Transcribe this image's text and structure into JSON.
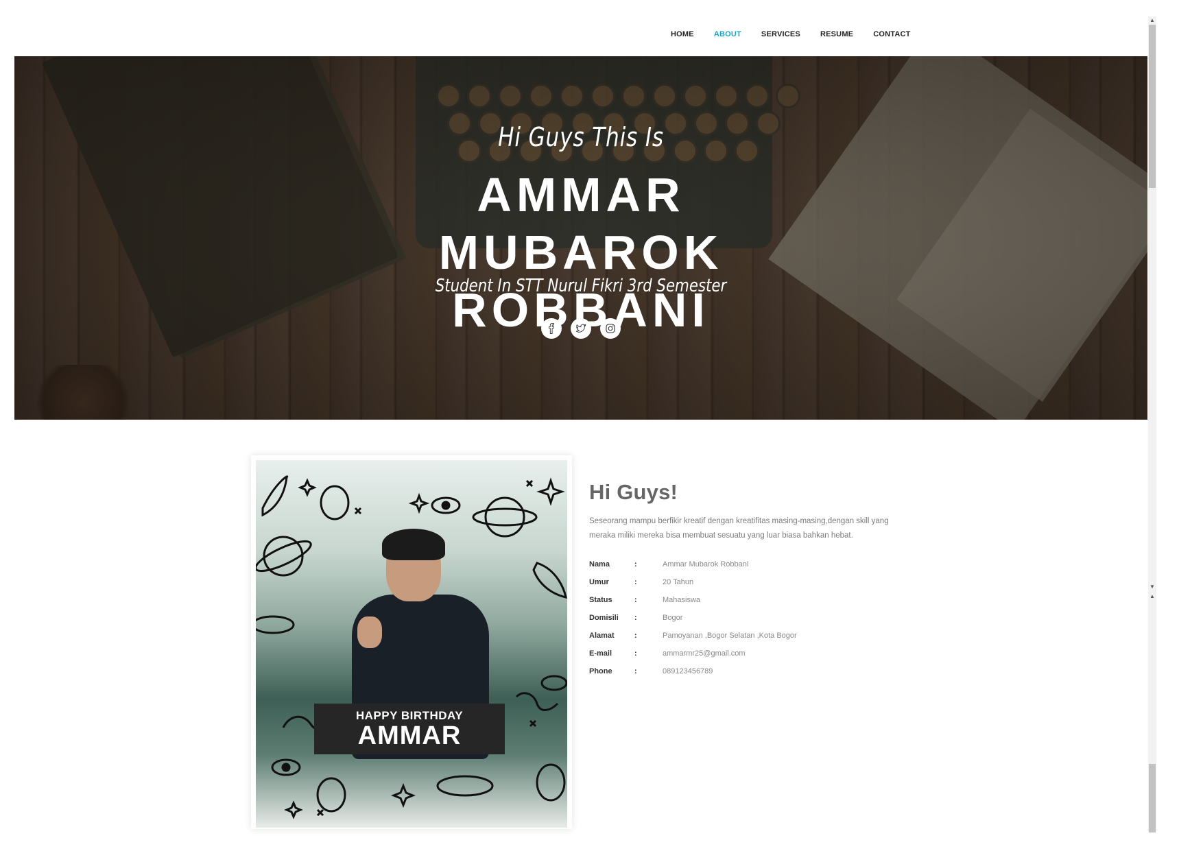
{
  "nav": {
    "items": [
      {
        "label": "HOME",
        "active": false
      },
      {
        "label": "ABOUT",
        "active": true
      },
      {
        "label": "SERVICES",
        "active": false
      },
      {
        "label": "RESUME",
        "active": false
      },
      {
        "label": "CONTACT",
        "active": false
      }
    ],
    "active_color": "#1aa3c8"
  },
  "hero": {
    "greeting": "Hi Guys This Is",
    "name_line1": "AMMAR MUBAROK",
    "name_line2": "ROBBANI",
    "subtitle": "Student In STT Nurul Fikri 3rd Semester",
    "socials": [
      "facebook-icon",
      "twitter-icon",
      "instagram-icon"
    ]
  },
  "photo": {
    "banner_top": "HAPPY BIRTHDAY",
    "banner_main": "AMMAR"
  },
  "about": {
    "title": "Hi Guys!",
    "description": "Seseorang mampu berfikir kreatif dengan kreatifitas masing-masing,dengan skill yang meraka miliki mereka bisa membuat sesuatu yang luar biasa bahkan hebat.",
    "colon": ":",
    "details": [
      {
        "label": "Nama",
        "value": "Ammar Mubarok Robbani"
      },
      {
        "label": "Umur",
        "value": "20 Tahun"
      },
      {
        "label": "Status",
        "value": "Mahasiswa"
      },
      {
        "label": "Domisili",
        "value": "Bogor"
      },
      {
        "label": "Alamat",
        "value": "Pamoyanan ,Bogor Selatan ,Kota Bogor"
      },
      {
        "label": "E-mail",
        "value": "ammarmr25@gmail.com"
      },
      {
        "label": "Phone",
        "value": "089123456789"
      }
    ]
  }
}
